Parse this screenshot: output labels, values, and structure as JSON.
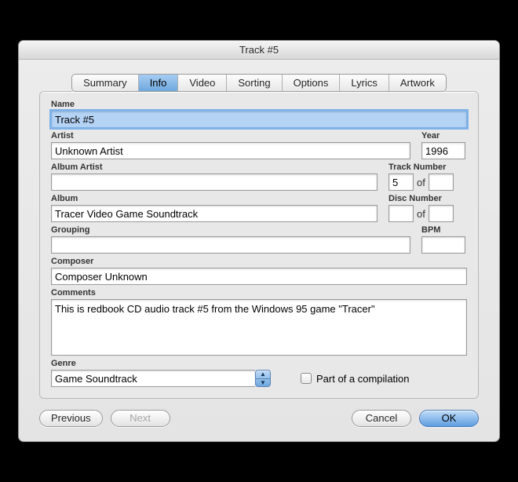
{
  "title": "Track #5",
  "tabs": [
    "Summary",
    "Info",
    "Video",
    "Sorting",
    "Options",
    "Lyrics",
    "Artwork"
  ],
  "active_tab": "Info",
  "labels": {
    "name": "Name",
    "artist": "Artist",
    "year": "Year",
    "album_artist": "Album Artist",
    "track_number": "Track Number",
    "album": "Album",
    "disc_number": "Disc Number",
    "grouping": "Grouping",
    "bpm": "BPM",
    "composer": "Composer",
    "comments": "Comments",
    "genre": "Genre",
    "of": "of",
    "compilation": "Part of a compilation"
  },
  "values": {
    "name": "Track #5",
    "artist": "Unknown Artist",
    "year": "1996",
    "album_artist": "",
    "track_num": "5",
    "track_total": "",
    "album": "Tracer Video Game Soundtrack",
    "disc_num": "",
    "disc_total": "",
    "grouping": "",
    "bpm": "",
    "composer": "Composer Unknown",
    "comments": "This is redbook CD audio track #5 from the Windows 95 game \"Tracer\"",
    "genre": "Game Soundtrack",
    "compilation_checked": false
  },
  "buttons": {
    "previous": "Previous",
    "next": "Next",
    "cancel": "Cancel",
    "ok": "OK"
  }
}
